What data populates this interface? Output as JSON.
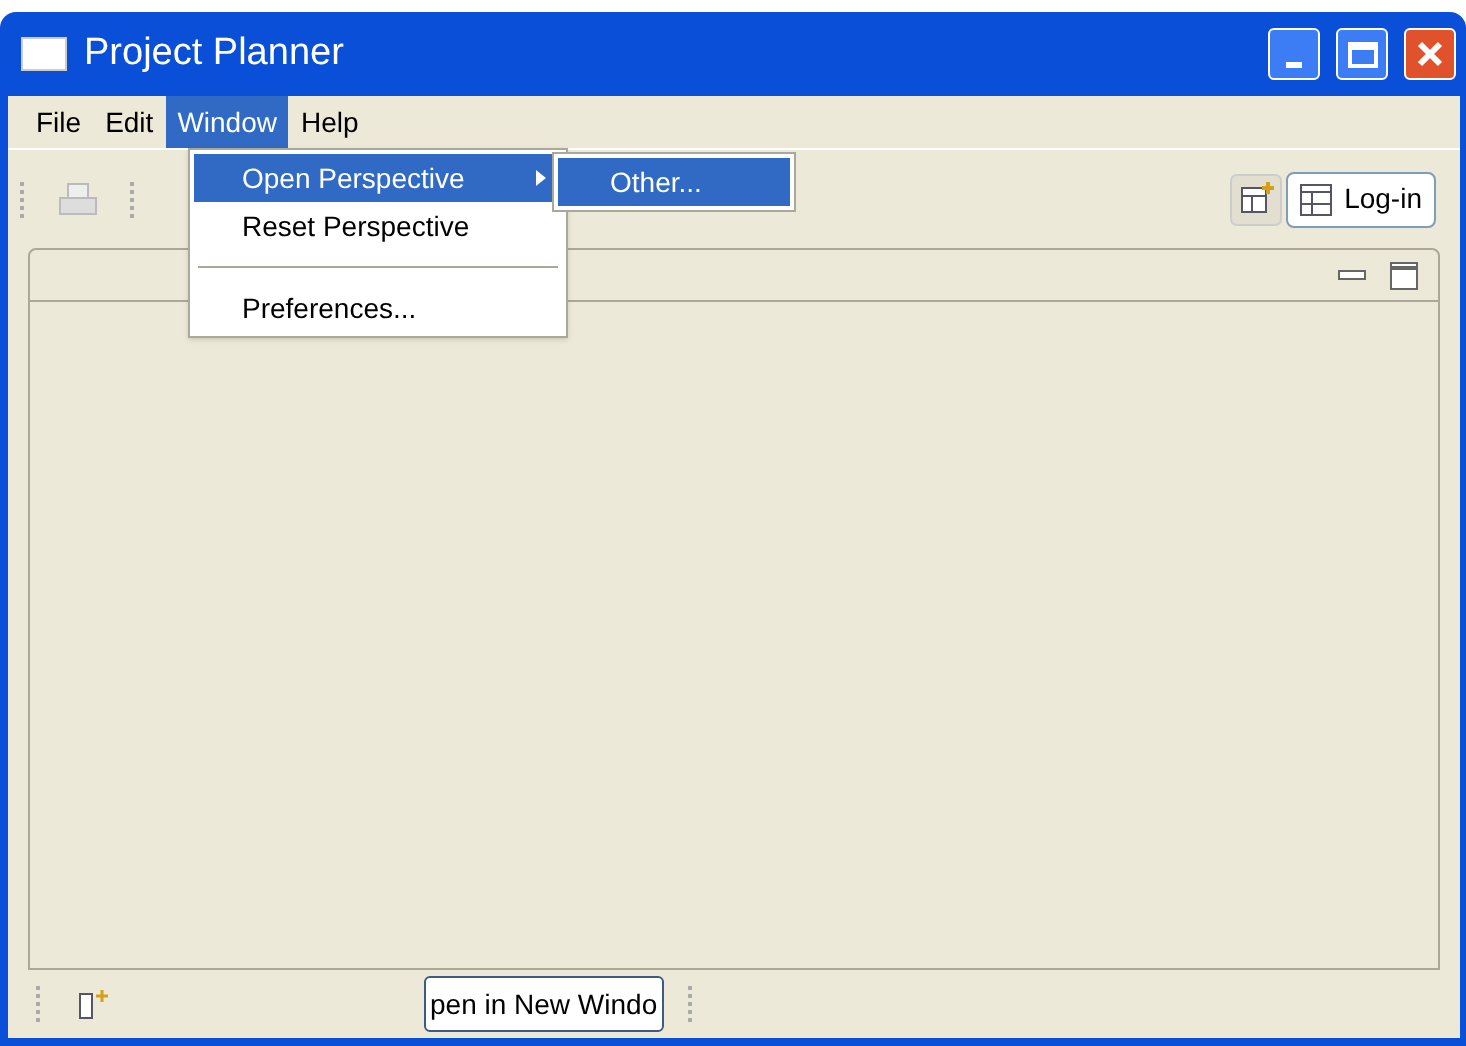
{
  "window": {
    "title": "Project Planner"
  },
  "menu_bar": [
    {
      "label": "File",
      "selected": false
    },
    {
      "label": "Edit",
      "selected": false
    },
    {
      "label": "Window",
      "selected": true
    },
    {
      "label": "Help",
      "selected": false
    }
  ],
  "menu": {
    "items": [
      {
        "kind": "item",
        "label": "Open Perspective",
        "submenu": true,
        "selected": true
      },
      {
        "kind": "item",
        "label": "Reset Perspective",
        "submenu": false,
        "selected": false
      },
      {
        "kind": "separator"
      },
      {
        "kind": "item",
        "label": "Preferences...",
        "submenu": false,
        "selected": false
      }
    ]
  },
  "submenu": {
    "items": [
      {
        "label": "Other...",
        "selected": true
      }
    ]
  },
  "perspectives": [
    {
      "label": "Log-in",
      "selected": true
    }
  ],
  "status_bar": {
    "button": "pen in New Windo"
  }
}
